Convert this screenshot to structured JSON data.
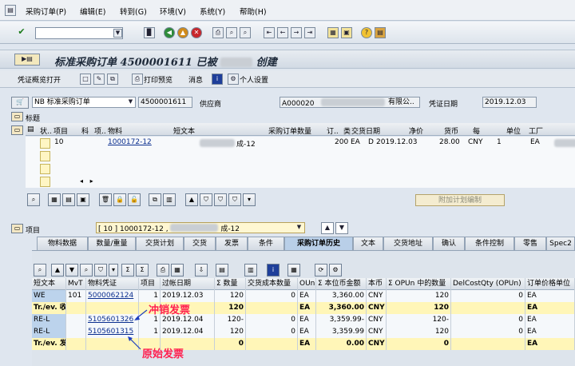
{
  "menu": [
    "采购订单(P)",
    "编辑(E)",
    "转到(G)",
    "环境(V)",
    "系统(Y)",
    "帮助(H)"
  ],
  "title": "标准采购订单 4500001611 已被",
  "title_suffix": "创建",
  "toolbar2": {
    "overview": "凭证概览打开",
    "print_preview": "打印预览",
    "messages": "消息",
    "personal": "个人设置"
  },
  "header": {
    "doc_type": "NB 标准采购订单",
    "po_number": "4500001611",
    "vendor_label": "供应商",
    "vendor_id": "A000020",
    "vendor_name_tail": "有限公..",
    "doc_date_label": "凭证日期",
    "doc_date": "2019.12.03",
    "section_title": "标题"
  },
  "items_grid": {
    "columns": [
      "状..",
      "项目",
      "科",
      "项..",
      "物料",
      "短文本",
      "采购订单数量",
      "订..",
      "类",
      "交货日期",
      "净价",
      "货币",
      "每",
      "单位",
      "工厂"
    ],
    "rows": [
      {
        "item": "10",
        "material": "1000172-12",
        "short_text_tail": "成-12",
        "qty": "200",
        "unit": "EA",
        "cat": "D",
        "delivery": "2019.12.03",
        "price": "28.00",
        "currency": "CNY",
        "per": "1",
        "uom": "EA",
        "plant_tail": "工厂"
      }
    ],
    "extra_plan_button": "附加计划编制"
  },
  "item_section": {
    "label": "项目",
    "selector_value": "[ 10 ] 1000172-12 ,",
    "selector_tail": "成-12"
  },
  "tabs": [
    "物料数据",
    "数量/重量",
    "交货计划",
    "交货",
    "发票",
    "条件",
    "采购订单历史",
    "文本",
    "交货地址",
    "确认",
    "条件控制",
    "零售",
    "Spec2"
  ],
  "active_tab": "采购订单历史",
  "history_table": {
    "columns": [
      "短文本",
      "MvT",
      "物料凭证",
      "项目",
      "过帐日期",
      "Σ 数量",
      "交货成本数量",
      "OUn",
      "Σ 本位币金额",
      "本币",
      "Σ OPUn 中的数量",
      "DelCostQty (OPUn)",
      "订单价格单位"
    ],
    "rows": [
      {
        "type": "normal",
        "short": "WE",
        "mvt": "101",
        "doc": "5000062124",
        "item": "1",
        "date": "2019.12.03",
        "qty": "120",
        "dcq": "0",
        "oun": "EA",
        "amt": "3,360.00",
        "cur": "CNY",
        "opun": "120",
        "dcq2": "0",
        "opu": "EA"
      },
      {
        "type": "sum",
        "short": "Tr./ev. 收货",
        "mvt": "",
        "doc": "",
        "item": "",
        "date": "",
        "qty": "120",
        "dcq": "",
        "oun": "EA",
        "amt": "3,360.00",
        "cur": "CNY",
        "opun": "120",
        "dcq2": "",
        "opu": "EA"
      },
      {
        "type": "normal",
        "short": "RE-L",
        "mvt": "",
        "doc": "5105601326",
        "item": "1",
        "date": "2019.12.04",
        "qty": "120-",
        "dcq": "0",
        "oun": "EA",
        "amt": "3,359.99-",
        "cur": "CNY",
        "opun": "120-",
        "dcq2": "0",
        "opu": "EA"
      },
      {
        "type": "normal",
        "short": "RE-L",
        "mvt": "",
        "doc": "5105601315",
        "item": "1",
        "date": "2019.12.04",
        "qty": "120",
        "dcq": "0",
        "oun": "EA",
        "amt": "3,359.99",
        "cur": "CNY",
        "opun": "120",
        "dcq2": "0",
        "opu": "EA"
      },
      {
        "type": "sum",
        "short": "Tr./ev. 发票收据",
        "mvt": "",
        "doc": "",
        "item": "",
        "date": "",
        "qty": "0",
        "dcq": "",
        "oun": "EA",
        "amt": "0.00",
        "cur": "CNY",
        "opun": "0",
        "dcq2": "",
        "opu": "EA"
      }
    ]
  },
  "annotations": {
    "reversal": "冲销发票",
    "original": "原始发票"
  },
  "colors": {
    "annotation": "#ff1f4f",
    "sum_row": "#fff6b8",
    "active_tab": "#b9cfe8"
  }
}
